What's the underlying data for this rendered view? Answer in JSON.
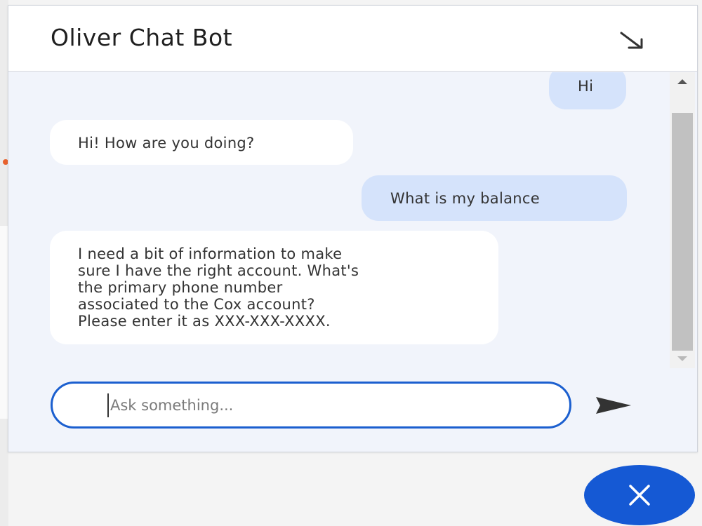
{
  "header": {
    "title": "Oliver Chat Bot",
    "minimize_icon": "arrow-down-right-icon"
  },
  "messages": [
    {
      "sender": "user",
      "text": "Hi"
    },
    {
      "sender": "bot",
      "text": "Hi! How are you doing?"
    },
    {
      "sender": "user",
      "text": "What is my balance"
    },
    {
      "sender": "bot",
      "text": "I need a bit of information to make\nsure I have the right account. What's\nthe primary phone number\nassociated to the Cox account?\nPlease enter it as XXX-XXX-XXXX."
    }
  ],
  "input": {
    "placeholder": "Ask something...",
    "value": ""
  },
  "send_icon": "send-icon",
  "close_icon": "close-icon",
  "colors": {
    "accent": "#1559d4",
    "user_bubble": "#d5e3fb",
    "bot_bubble": "#ffffff",
    "chat_background": "#f1f4fb"
  }
}
